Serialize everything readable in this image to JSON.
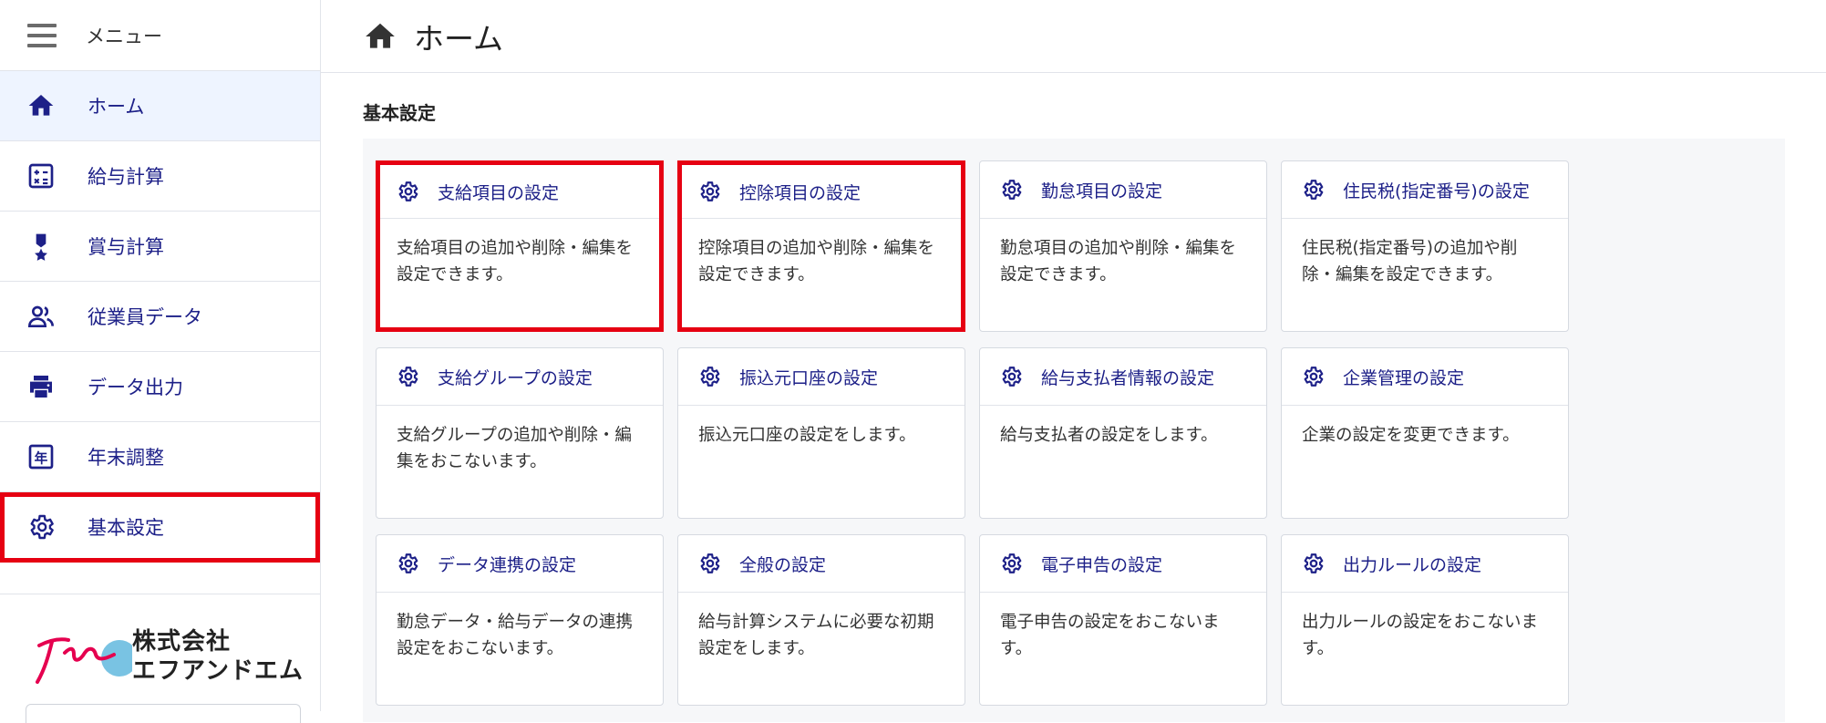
{
  "sidebar": {
    "menu_title": "メニュー",
    "items": [
      {
        "label": "ホーム",
        "icon": "home-icon"
      },
      {
        "label": "給与計算",
        "icon": "calculator-icon"
      },
      {
        "label": "賞与計算",
        "icon": "medal-icon"
      },
      {
        "label": "従業員データ",
        "icon": "people-icon"
      },
      {
        "label": "データ出力",
        "icon": "printer-icon"
      },
      {
        "label": "年末調整",
        "icon": "year-calendar-icon"
      },
      {
        "label": "基本設定",
        "icon": "gear-icon"
      }
    ],
    "active_item": "ホーム",
    "logo": {
      "line1": "株式会社",
      "line2": "エフアンドエム"
    }
  },
  "header": {
    "title": "ホーム",
    "icon": "home-icon"
  },
  "section": {
    "title": "基本設定"
  },
  "cards": [
    {
      "title": "支給項目の設定",
      "desc": "支給項目の追加や削除・編集を設定できます。"
    },
    {
      "title": "控除項目の設定",
      "desc": "控除項目の追加や削除・編集を設定できます。"
    },
    {
      "title": "勤怠項目の設定",
      "desc": "勤怠項目の追加や削除・編集を設定できます。"
    },
    {
      "title": "住民税(指定番号)の設定",
      "desc": "住民税(指定番号)の追加や削除・編集を設定できます。"
    },
    {
      "title": "支給グループの設定",
      "desc": "支給グループの追加や削除・編集をおこないます。"
    },
    {
      "title": "振込元口座の設定",
      "desc": "振込元口座の設定をします。"
    },
    {
      "title": "給与支払者情報の設定",
      "desc": "給与支払者の設定をします。"
    },
    {
      "title": "企業管理の設定",
      "desc": "企業の設定を変更できます。"
    },
    {
      "title": "データ連携の設定",
      "desc": "勤怠データ・給与データの連携設定をおこないます。"
    },
    {
      "title": "全般の設定",
      "desc": "給与計算システムに必要な初期設定をします。"
    },
    {
      "title": "電子申告の設定",
      "desc": "電子申告の設定をおこないます。"
    },
    {
      "title": "出力ルールの設定",
      "desc": "出力ルールの設定をおこないます。"
    }
  ],
  "colors": {
    "accent": "#1d2088",
    "highlight": "#e60012",
    "active_bg": "#eef4ff"
  }
}
